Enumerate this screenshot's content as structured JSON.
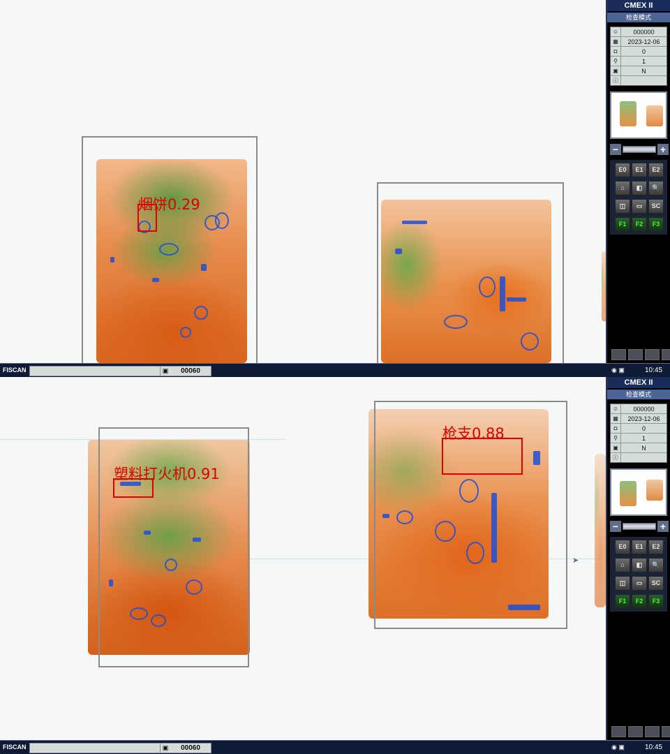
{
  "app": {
    "brand": "CMEX II",
    "mode": "检查模式"
  },
  "info": {
    "operator": "000000",
    "date": "2023-12-06",
    "count": "0",
    "zoom": "1",
    "flag": "N",
    "note": ""
  },
  "buttons": [
    "E0",
    "E1",
    "E2",
    "⌂",
    "◧",
    "🔍",
    "◫",
    "▭",
    "SC",
    "F1",
    "F2",
    "F3"
  ],
  "statusbar": {
    "brand": "FISCAN",
    "bag_count": "00060",
    "time": "10:45"
  },
  "top": {
    "detections": [
      {
        "label": "烟饼0.29",
        "color": "#e00000"
      }
    ]
  },
  "bottom": {
    "detections": [
      {
        "label": "塑料打火机0.91",
        "color": "#e00000"
      },
      {
        "label": "枪支0.88",
        "color": "#e00000"
      }
    ]
  },
  "icons": {
    "operator": "user-icon",
    "date": "calendar-icon",
    "count": "counter-icon",
    "zoom": "magnifier-icon",
    "flag": "bag-icon",
    "note": "info-icon"
  }
}
